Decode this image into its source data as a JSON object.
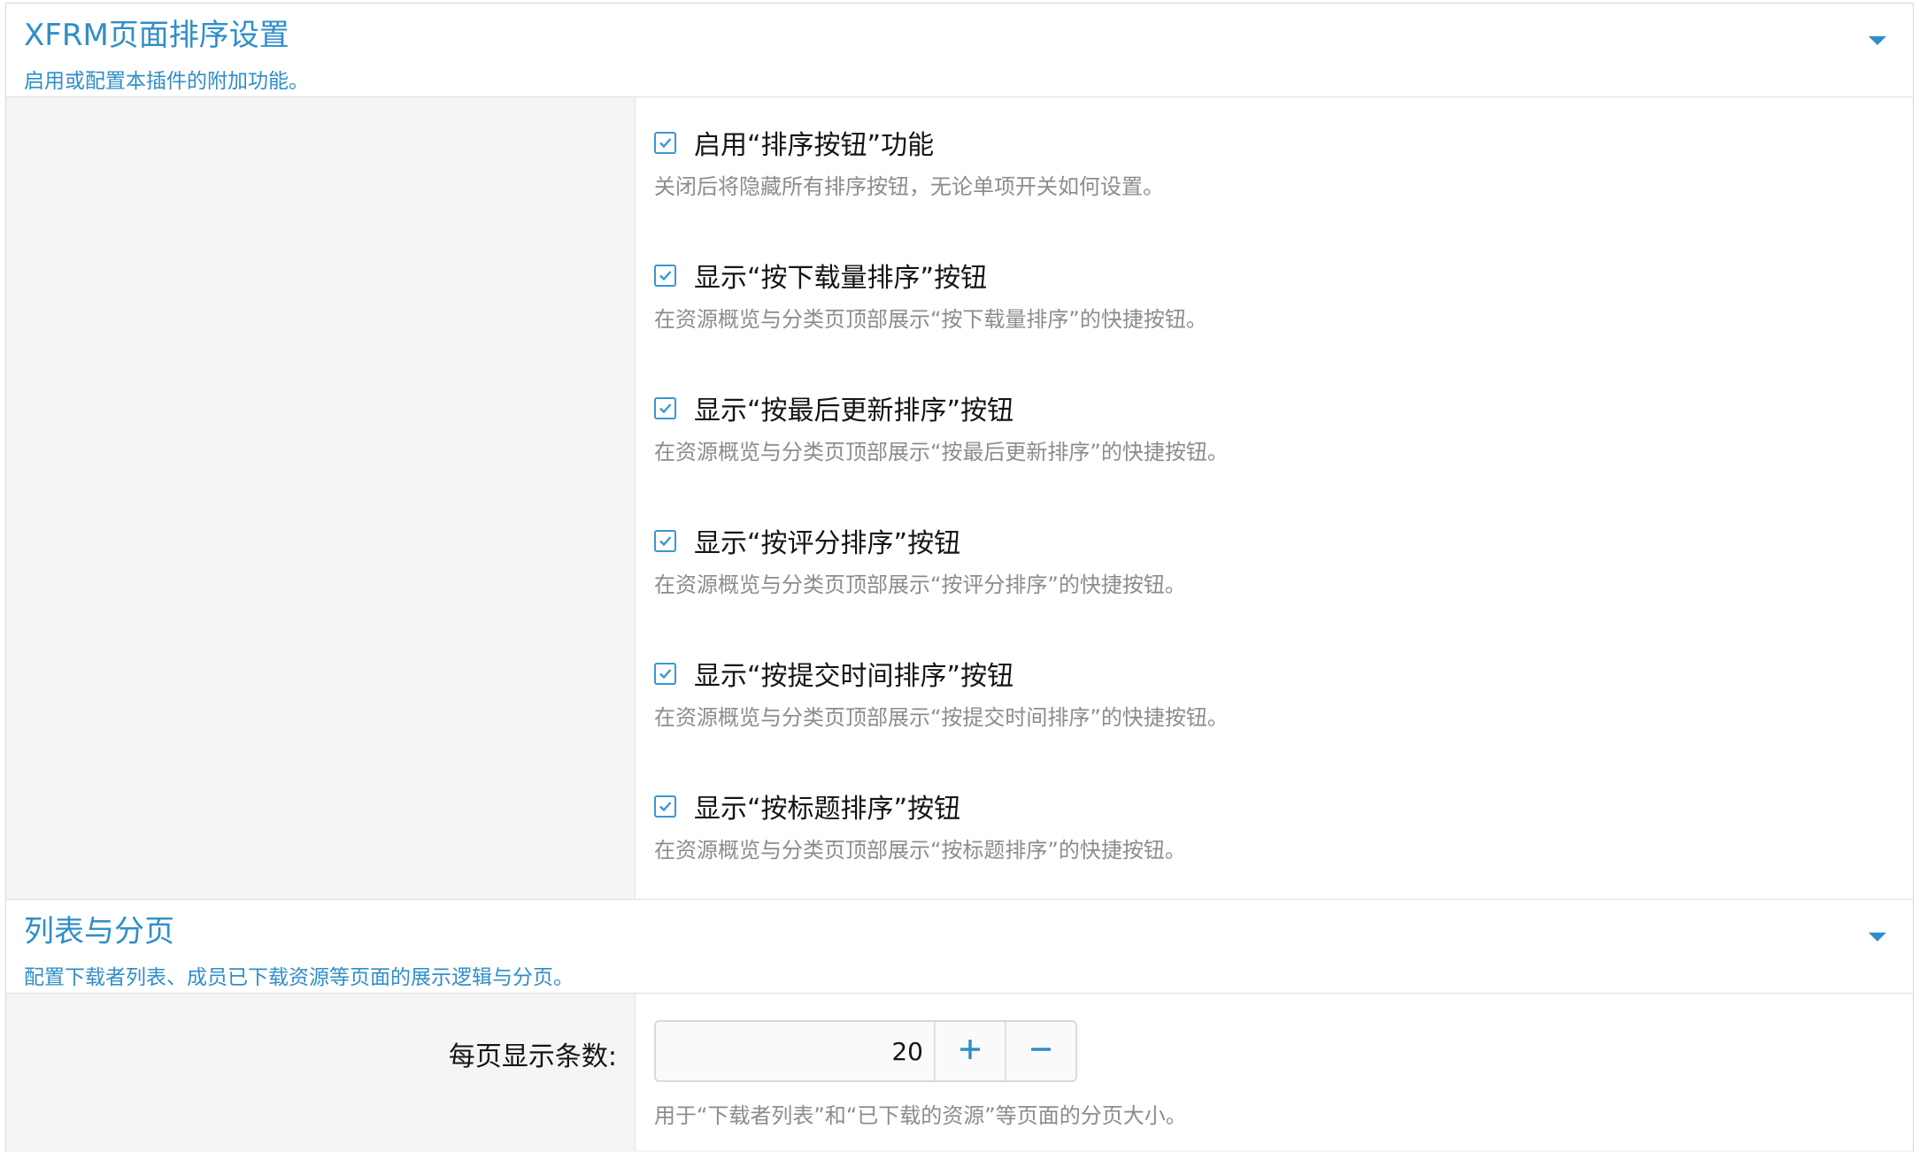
{
  "sort_section": {
    "title": "XFRM页面排序设置",
    "description": "启用或配置本插件的附加功能。",
    "collapse_icon": "caret-down-icon",
    "options": [
      {
        "label": "启用“排序按钮”功能",
        "hint": "关闭后将隐藏所有排序按钮，无论单项开关如何设置。",
        "checked": true
      },
      {
        "label": "显示“按下载量排序”按钮",
        "hint": "在资源概览与分类页顶部展示“按下载量排序”的快捷按钮。",
        "checked": true
      },
      {
        "label": "显示“按最后更新排序”按钮",
        "hint": "在资源概览与分类页顶部展示“按最后更新排序”的快捷按钮。",
        "checked": true
      },
      {
        "label": "显示“按评分排序”按钮",
        "hint": "在资源概览与分类页顶部展示“按评分排序”的快捷按钮。",
        "checked": true
      },
      {
        "label": "显示“按提交时间排序”按钮",
        "hint": "在资源概览与分类页顶部展示“按提交时间排序”的快捷按钮。",
        "checked": true
      },
      {
        "label": "显示“按标题排序”按钮",
        "hint": "在资源概览与分类页顶部展示“按标题排序”的快捷按钮。",
        "checked": true
      }
    ]
  },
  "list_section": {
    "title": "列表与分页",
    "description": "配置下载者列表、成员已下载资源等页面的展示逻辑与分页。",
    "collapse_icon": "caret-down-icon",
    "per_page": {
      "label": "每页显示条数:",
      "value": "20",
      "increment_icon": "plus-icon",
      "decrement_icon": "minus-icon",
      "hint": "用于“下载者列表”和“已下载的资源”等页面的分页大小。"
    }
  },
  "colors": {
    "accent": "#2f8ec8",
    "checkbox": "#3a97d3",
    "hint_text": "#8c8c8c",
    "label_bg": "#f5f5f5"
  }
}
